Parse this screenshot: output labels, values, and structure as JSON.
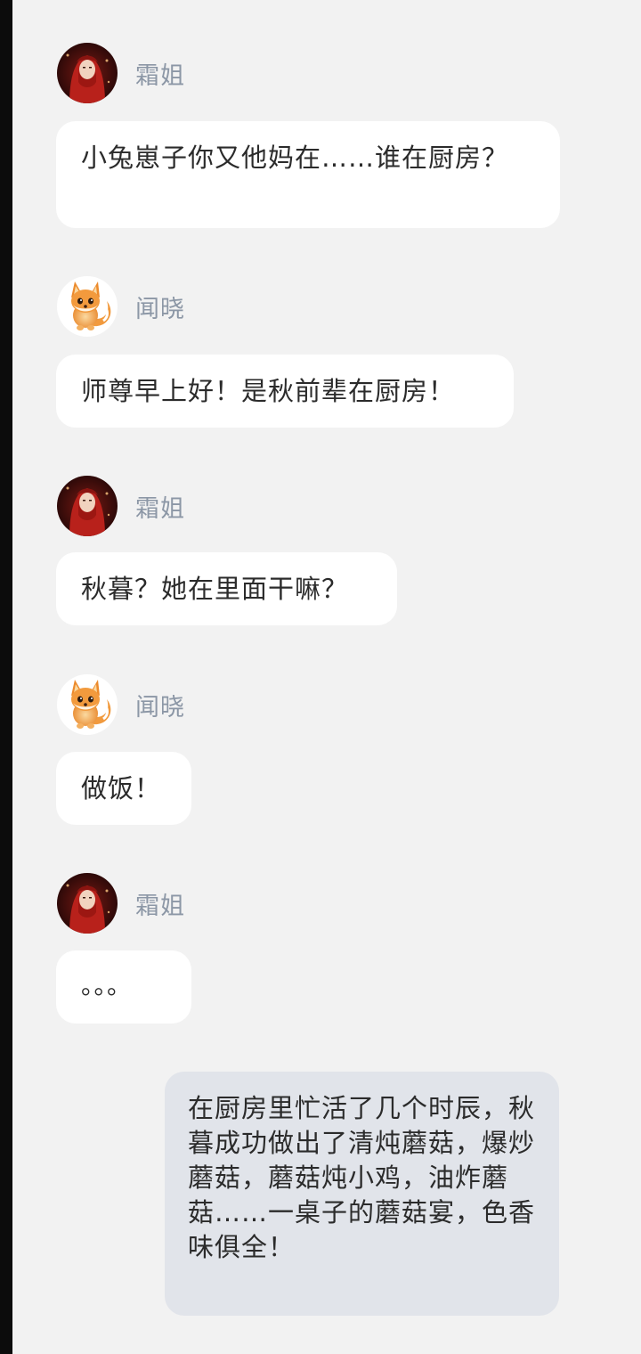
{
  "chat": {
    "messages": [
      {
        "sender": "霜姐",
        "avatar_icon": "red-hooded-woman-avatar",
        "text": "小兔崽子你又他妈在……谁在厨房？"
      },
      {
        "sender": "闻晓",
        "avatar_icon": "fox-avatar",
        "text": "师尊早上好！是秋前辈在厨房！"
      },
      {
        "sender": "霜姐",
        "avatar_icon": "red-hooded-woman-avatar",
        "text": "秋暮？她在里面干嘛？"
      },
      {
        "sender": "闻晓",
        "avatar_icon": "fox-avatar",
        "text": "做饭！"
      },
      {
        "sender": "霜姐",
        "avatar_icon": "red-hooded-woman-avatar",
        "text": "。。。"
      },
      {
        "sender": "",
        "text": "在厨房里忙活了几个时辰，秋暮成功做出了清炖蘑菇，爆炒蘑菇，蘑菇炖小鸡，油炸蘑菇……一桌子的蘑菇宴，色香味俱全！"
      }
    ]
  },
  "colors": {
    "background": "#f2f2f2",
    "bubble": "#ffffff",
    "self_bubble": "#e1e4ea",
    "name": "#8c97a6",
    "text": "#2b2b2b"
  }
}
